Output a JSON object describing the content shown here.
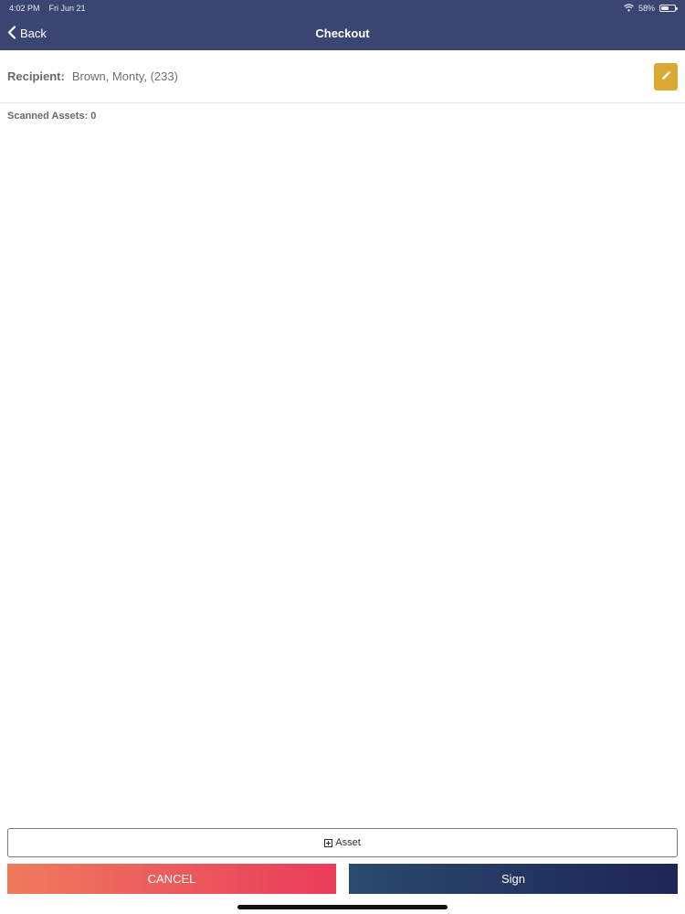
{
  "status_bar": {
    "time": "4:02 PM",
    "date": "Fri Jun 21",
    "battery_text": "58%",
    "battery_level": 0.58,
    "wifi_icon": "wifi-icon"
  },
  "nav": {
    "back_label": "Back",
    "title": "Checkout"
  },
  "recipient": {
    "label": "Recipient:",
    "value": "Brown, Monty, (233)",
    "edit_icon": "pencil-icon",
    "edit_color": "#d9a933"
  },
  "scanned": {
    "text": "Scanned Assets: 0"
  },
  "actions": {
    "add_asset_label": "Asset",
    "cancel_label": "CANCEL",
    "sign_label": "Sign"
  },
  "colors": {
    "header": "#3b4572",
    "cancel_start": "#ee7b5c",
    "cancel_end": "#ea3c5b",
    "sign_start": "#2a4a6e",
    "sign_end": "#1e2557"
  }
}
